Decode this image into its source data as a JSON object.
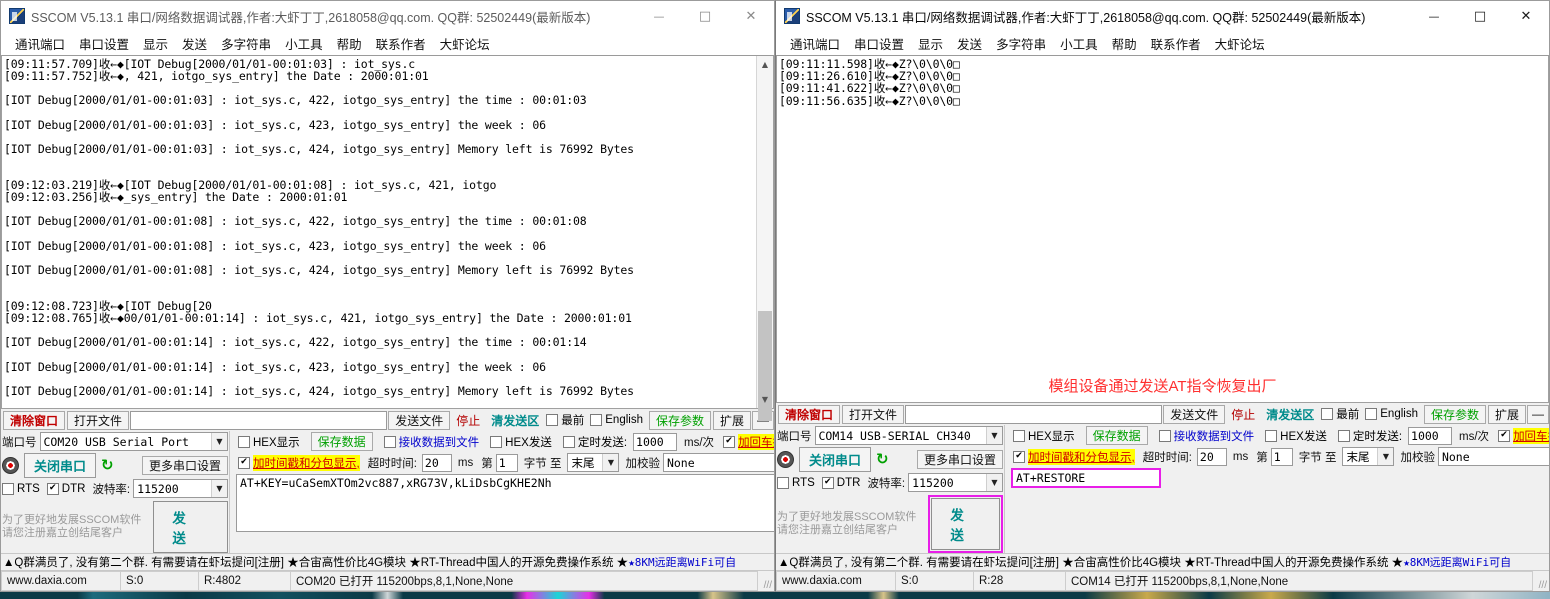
{
  "window": {
    "title": "SSCOM V5.13.1 串口/网络数据调试器,作者:大虾丁丁,2618058@qq.com. QQ群: 52502449(最新版本)",
    "icon": "sscom-app-icon",
    "minimize": "—",
    "maximize": "□",
    "close": "✕"
  },
  "menu": [
    "通讯端口",
    "串口设置",
    "显示",
    "发送",
    "多字符串",
    "小工具",
    "帮助",
    "联系作者",
    "大虾论坛"
  ],
  "toolbar": {
    "clear_window": "清除窗口",
    "open_file": "打开文件",
    "file_path": "",
    "send_file": "发送文件",
    "stop": "停止",
    "clear_send": "清发送区",
    "topmost": "最前",
    "english": "English",
    "save_params": "保存参数",
    "extend": "扩展",
    "collapse": "—"
  },
  "serial": {
    "port_label": "端口号",
    "close_port": "关闭串口",
    "refresh_icon": "↻",
    "more_settings": "更多串口设置",
    "rts_label": "RTS",
    "dtr_label": "DTR",
    "baud_label": "波特率:",
    "baud_value": "115200",
    "dropdown_arrow": "▼"
  },
  "options": {
    "hex_display": "HEX显示",
    "save_data": "保存数据",
    "recv_to_file": "接收数据到文件",
    "hex_send": "HEX发送",
    "timed_send": "定时发送:",
    "timed_value": "1000",
    "timed_unit": "ms/次",
    "add_crlf": "加回车换行",
    "help_mark": "?",
    "timestamp_pack": "加时间戳和分包显示,",
    "timeout_label": "超时时间:",
    "timeout_value": "20",
    "timeout_unit": "ms",
    "byte_prefix": "第",
    "byte_index": "1",
    "byte_label": "字节 至",
    "byte_end": "末尾",
    "checksum_label": "加校验",
    "checksum_value": "None"
  },
  "promo": {
    "line1": "为了更好地发展SSCOM软件",
    "line2": "请您注册嘉立创结尾客户",
    "send_button": "发 送"
  },
  "ad_bar": {
    "text": "▲Q群满员了, 没有第二个群. 有需要请在虾坛提问[注册] ★合宙高性价比4G模块  ★RT-Thread中国人的开源免费操作系统  ★ ",
    "blue_text": "★8KM远距离WiFi可自"
  },
  "left_panel": {
    "port_value": "COM20 USB Serial Port",
    "send_text": "AT+KEY=uCaSemXTOm2vc887,xRG73V,kLiDsbCgKHE2Nh",
    "status": {
      "site": "www.daxia.com",
      "sent": "S:0",
      "received": "R:4802",
      "conn": "COM20 已打开  115200bps,8,1,None,None"
    },
    "log": [
      "[09:11:57.709]收←◆[IOT Debug[2000/01/01-00:01:03] : iot_sys.c",
      "[09:11:57.752]收←◆, 421, iotgo_sys_entry] the Date : 2000:01:01",
      "",
      "[IOT Debug[2000/01/01-00:01:03] : iot_sys.c, 422, iotgo_sys_entry] the time : 00:01:03",
      "",
      "[IOT Debug[2000/01/01-00:01:03] : iot_sys.c, 423, iotgo_sys_entry] the week : 06",
      "",
      "[IOT Debug[2000/01/01-00:01:03] : iot_sys.c, 424, iotgo_sys_entry] Memory left is 76992 Bytes",
      "",
      "",
      "[09:12:03.219]收←◆[IOT Debug[2000/01/01-00:01:08] : iot_sys.c, 421, iotgo",
      "[09:12:03.256]收←◆_sys_entry] the Date : 2000:01:01",
      "",
      "[IOT Debug[2000/01/01-00:01:08] : iot_sys.c, 422, iotgo_sys_entry] the time : 00:01:08",
      "",
      "[IOT Debug[2000/01/01-00:01:08] : iot_sys.c, 423, iotgo_sys_entry] the week : 06",
      "",
      "[IOT Debug[2000/01/01-00:01:08] : iot_sys.c, 424, iotgo_sys_entry] Memory left is 76992 Bytes",
      "",
      "",
      "[09:12:08.723]收←◆[IOT Debug[20",
      "[09:12:08.765]收←◆00/01/01-00:01:14] : iot_sys.c, 421, iotgo_sys_entry] the Date : 2000:01:01",
      "",
      "[IOT Debug[2000/01/01-00:01:14] : iot_sys.c, 422, iotgo_sys_entry] the time : 00:01:14",
      "",
      "[IOT Debug[2000/01/01-00:01:14] : iot_sys.c, 423, iotgo_sys_entry] the week : 06",
      "",
      "[IOT Debug[2000/01/01-00:01:14] : iot_sys.c, 424, iotgo_sys_entry] Memory left is 76992 Bytes"
    ]
  },
  "right_panel": {
    "port_value": "COM14 USB-SERIAL CH340",
    "send_text": "AT+RESTORE",
    "annotation": "模组设备通过发送AT指令恢复出厂",
    "status": {
      "site": "www.daxia.com",
      "sent": "S:0",
      "received": "R:28",
      "conn": "COM14 已打开  115200bps,8,1,None,None"
    },
    "log": [
      "[09:11:11.598]收←◆Z?\\0\\0\\0□",
      "[09:11:26.610]收←◆Z?\\0\\0\\0□",
      "[09:11:41.622]收←◆Z?\\0\\0\\0□",
      "[09:11:56.635]收←◆Z?\\0\\0\\0□"
    ]
  },
  "colors": {
    "accent_red": "#c00000",
    "accent_teal": "#008b8b",
    "accent_green": "#00a000",
    "highlight_yellow": "#ffff00",
    "annotation_magenta": "#e81ee8",
    "annotation_red": "#ff2f2f"
  }
}
